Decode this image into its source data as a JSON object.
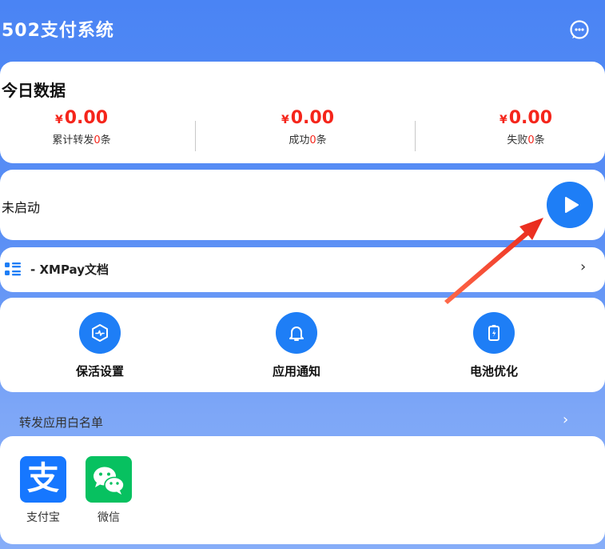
{
  "header": {
    "title": "502支付系统",
    "message_icon": "chat-bubble-icon"
  },
  "today": {
    "title": "今日数据",
    "stats": [
      {
        "currency": "¥",
        "amount": "0.00",
        "label_prefix": "累计转发",
        "count": "0",
        "label_suffix": "条"
      },
      {
        "currency": "¥",
        "amount": "0.00",
        "label_prefix": "成功",
        "count": "0",
        "label_suffix": "条"
      },
      {
        "currency": "¥",
        "amount": "0.00",
        "label_prefix": "失败",
        "count": "0",
        "label_suffix": "条"
      }
    ]
  },
  "service": {
    "status": "未启动",
    "play_icon": "play-icon"
  },
  "docs": {
    "label": "- XMPay文档",
    "icon": "list-icon",
    "chevron": "›"
  },
  "tools": [
    {
      "label": "保活设置",
      "icon": "keepalive-icon"
    },
    {
      "label": "应用通知",
      "icon": "bell-icon"
    },
    {
      "label": "电池优化",
      "icon": "battery-icon"
    }
  ],
  "whitelist": {
    "title": "转发应用白名单",
    "chevron": "›",
    "apps": [
      {
        "name": "支付宝",
        "icon": "alipay-icon",
        "glyph": "支",
        "color": "#1677ff"
      },
      {
        "name": "微信",
        "icon": "wechat-icon",
        "color": "#07c160"
      }
    ]
  },
  "colors": {
    "primary": "#1e7ef6",
    "accent_red": "#f5251b",
    "header_bg": "#4a84f4"
  }
}
